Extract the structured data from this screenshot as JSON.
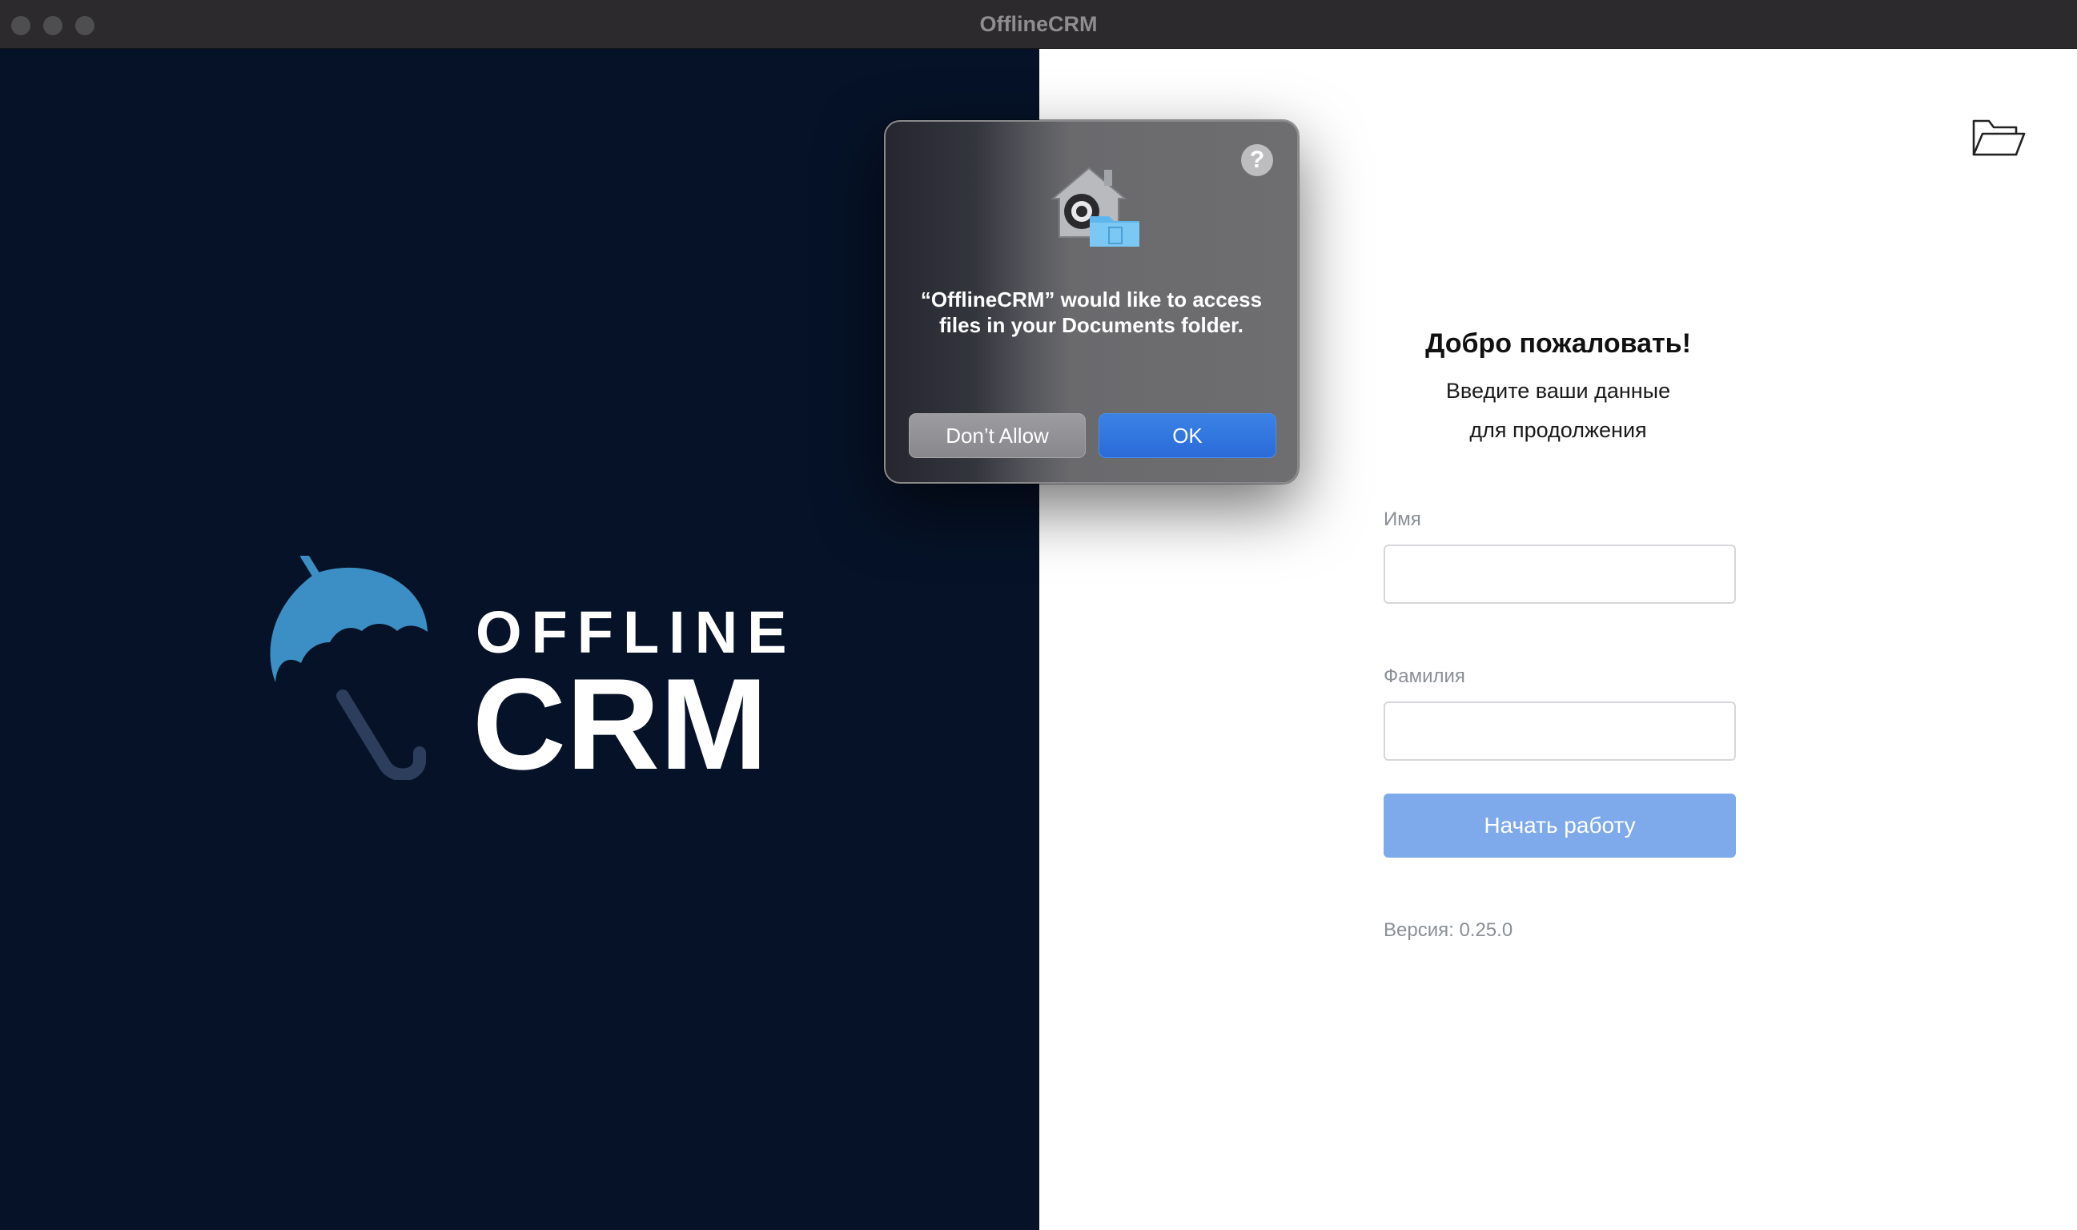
{
  "window": {
    "title": "OfflineCRM"
  },
  "brand": {
    "line1": "OFFLINE",
    "line2": "CRM"
  },
  "form": {
    "welcome": "Добро пожаловать!",
    "subtitle": "Введите ваши данные\nдля продолжения",
    "first_name": {
      "label": "Имя",
      "value": ""
    },
    "last_name": {
      "label": "Фамилия",
      "value": ""
    },
    "submit_label": "Начать работу",
    "version": "Версия: 0.25.0"
  },
  "dialog": {
    "message": "“OfflineCRM” would like to access files in your Documents folder.",
    "help_label": "?",
    "deny_label": "Don’t Allow",
    "ok_label": "OK"
  },
  "icons": {
    "umbrella": "umbrella-logo-icon",
    "folder": "folder-open-icon",
    "privacy": "privacy-home-folder-icon"
  },
  "colors": {
    "brand_panel": "#061227",
    "umbrella_blue": "#3c8fc4",
    "umbrella_handle": "#2c3e5c",
    "primary_button": "#7ea9ea",
    "dialog_ok": "#2f74de"
  }
}
